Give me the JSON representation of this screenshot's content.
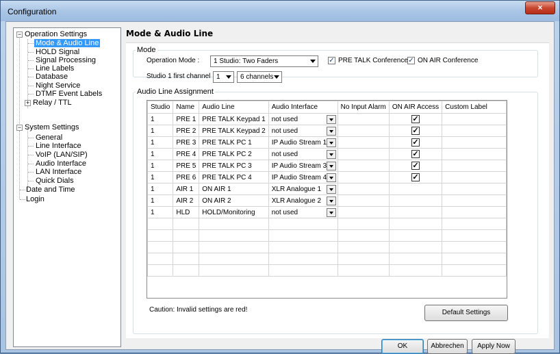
{
  "window": {
    "title": "Configuration",
    "close_glyph": "×"
  },
  "tree": {
    "operation_settings": "Operation Settings",
    "mode_audio_line": "Mode & Audio Line",
    "hold_signal": "HOLD Signal",
    "signal_processing": "Signal Processing",
    "line_labels": "Line Labels",
    "database": "Database",
    "night_service": "Night Service",
    "dtmf_event_labels": "DTMF Event Labels",
    "relay_ttl": "Relay / TTL",
    "system_settings": "System Settings",
    "general": "General",
    "line_interface": "Line Interface",
    "voip": "VoIP (LAN/SIP)",
    "audio_interface": "Audio Interface",
    "lan_interface": "LAN Interface",
    "quick_dials": "Quick Dials",
    "date_and_time": "Date and Time",
    "login": "Login",
    "expanded_glyph": "−",
    "collapsed_glyph": "+"
  },
  "panel": {
    "title": "Mode & Audio Line",
    "mode_group": "Mode",
    "operation_mode_label": "Operation Mode :",
    "operation_mode_value": "1 Studio: Two Faders",
    "pre_talk_conference": "PRE TALK Conference",
    "on_air_conference": "ON AIR Conference",
    "studio_first_channel_label": "Studio 1 first channel :",
    "first_channel_value": "1",
    "channels_value": "6 channels",
    "assignment_group": "Audio Line Assignment",
    "caution": "Caution: Invalid settings are red!",
    "default_settings": "Default Settings"
  },
  "table": {
    "headers": [
      "Studio",
      "Name",
      "Audio Line",
      "Audio Interface",
      "No Input Alarm",
      "ON AIR Access",
      "Custom Label"
    ],
    "rows": [
      {
        "studio": "1",
        "name": "PRE 1",
        "line": "PRE TALK Keypad 1",
        "iface": "not used",
        "access": "✓"
      },
      {
        "studio": "1",
        "name": "PRE 2",
        "line": "PRE TALK Keypad 2",
        "iface": "not used",
        "access": "✓"
      },
      {
        "studio": "1",
        "name": "PRE 3",
        "line": "PRE TALK PC 1",
        "iface": "IP Audio Stream 1",
        "access": "✓"
      },
      {
        "studio": "1",
        "name": "PRE 4",
        "line": "PRE TALK PC 2",
        "iface": "not used",
        "access": "✓"
      },
      {
        "studio": "1",
        "name": "PRE 5",
        "line": "PRE TALK PC 3",
        "iface": "IP Audio Stream 3",
        "access": "✓"
      },
      {
        "studio": "1",
        "name": "PRE 6",
        "line": "PRE TALK PC 4",
        "iface": "IP Audio Stream 4",
        "access": "✓"
      },
      {
        "studio": "1",
        "name": "AIR 1",
        "line": "ON AIR 1",
        "iface": "XLR Analogue 1",
        "access": ""
      },
      {
        "studio": "1",
        "name": "AIR 2",
        "line": "ON AIR 2",
        "iface": "XLR Analogue 2",
        "access": ""
      },
      {
        "studio": "1",
        "name": "HLD",
        "line": "HOLD/Monitoring",
        "iface": "not used",
        "access": ""
      }
    ],
    "checkmark": "✓"
  },
  "footer": {
    "ok": "OK",
    "cancel": "Abbrechen",
    "apply": "Apply Now"
  }
}
